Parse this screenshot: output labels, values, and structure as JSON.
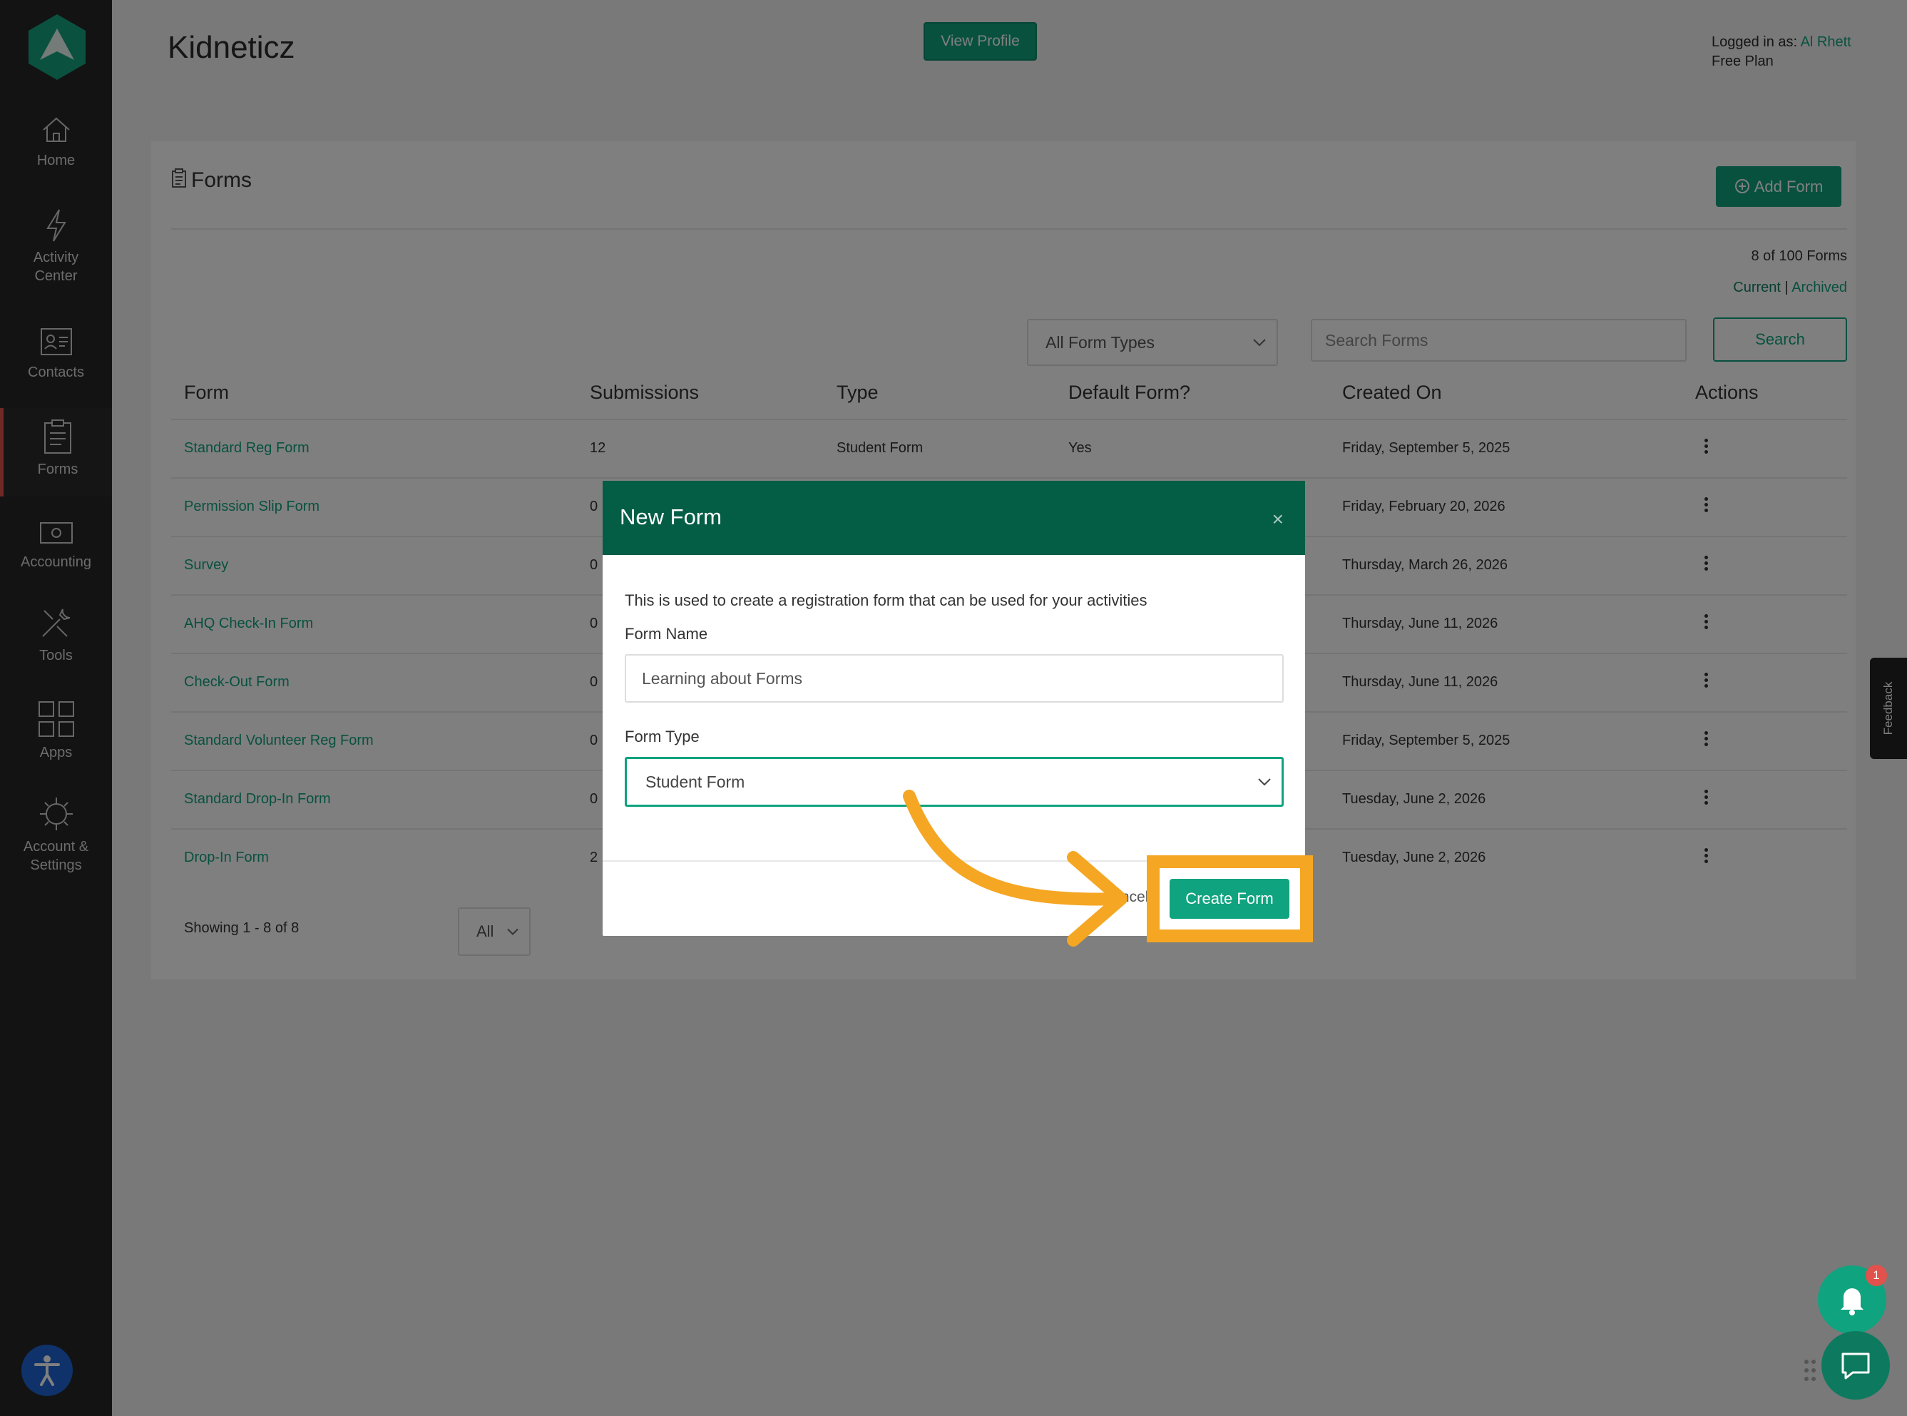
{
  "sidebar": {
    "items": [
      {
        "label": "Home",
        "icon": "home-icon"
      },
      {
        "label": "Activity Center",
        "icon": "lightning-icon"
      },
      {
        "label": "Contacts",
        "icon": "contacts-icon"
      },
      {
        "label": "Forms",
        "icon": "clipboard-icon"
      },
      {
        "label": "Accounting",
        "icon": "money-icon"
      },
      {
        "label": "Tools",
        "icon": "tools-icon"
      },
      {
        "label": "Apps",
        "icon": "apps-grid-icon"
      },
      {
        "label": "Account & Settings",
        "icon": "gear-icon"
      }
    ],
    "active": "Forms"
  },
  "header": {
    "title": "Kidneticz",
    "view_profile": "View Profile",
    "logged_in_prefix": "Logged in as: ",
    "user": "Al Rhett",
    "plan": "Free Plan"
  },
  "forms": {
    "heading": "Forms",
    "add_label": "Add Form",
    "count": "8 of 100 Forms",
    "filter_current": "Current",
    "filter_sep": " | ",
    "filter_archived": "Archived",
    "type_filter": "All Form Types",
    "search_placeholder": "Search Forms",
    "search_label": "Search",
    "columns": [
      "Form",
      "Submissions",
      "Type",
      "Default Form?",
      "Created On",
      "Actions"
    ],
    "rows": [
      {
        "name": "Standard Reg Form",
        "submissions": "12",
        "type": "Student Form",
        "default": "Yes",
        "created": "Friday, September 5, 2025"
      },
      {
        "name": "Permission Slip Form",
        "submissions": "0",
        "type": "",
        "default": "",
        "created": "Friday, February 20, 2026"
      },
      {
        "name": "Survey",
        "submissions": "0",
        "type": "",
        "default": "",
        "created": "Thursday, March 26, 2026"
      },
      {
        "name": "AHQ Check-In Form",
        "submissions": "0",
        "type": "",
        "default": "",
        "created": "Thursday, June 11, 2026"
      },
      {
        "name": "Check-Out Form",
        "submissions": "0",
        "type": "",
        "default": "",
        "created": "Thursday, June 11, 2026"
      },
      {
        "name": "Standard Volunteer Reg Form",
        "submissions": "0",
        "type": "",
        "default": "",
        "created": "Friday, September 5, 2025"
      },
      {
        "name": "Standard Drop-In Form",
        "submissions": "0",
        "type": "",
        "default": "",
        "created": "Tuesday, June 2, 2026"
      },
      {
        "name": "Drop-In Form",
        "submissions": "2",
        "type": "",
        "default": "",
        "created": "Tuesday, June 2, 2026"
      }
    ],
    "showing": "Showing 1 - 8 of 8",
    "page_size": "All"
  },
  "modal": {
    "title": "New Form",
    "close": "×",
    "description": "This is used to create a registration form that can be used for your activities",
    "name_label": "Form Name",
    "name_value": "Learning about Forms",
    "type_label": "Form Type",
    "type_value": "Student Form",
    "cancel_label": "Cancel",
    "create_label": "Create Form"
  },
  "feedback": "Feedback",
  "notifications": {
    "count": "1"
  },
  "colors": {
    "accent": "#10a37f",
    "modal_header": "#035e45",
    "highlight": "#f5a623",
    "sidebar": "#262626"
  }
}
